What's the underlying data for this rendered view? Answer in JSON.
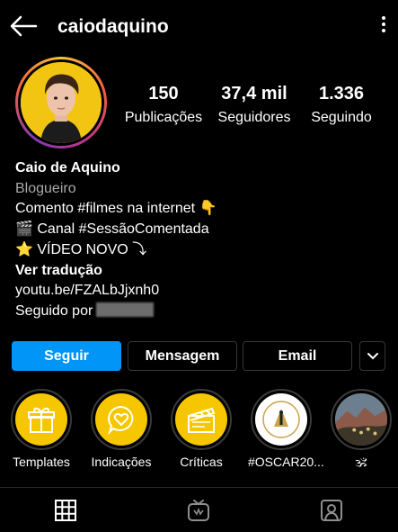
{
  "header": {
    "username": "caiodaquino"
  },
  "stats": [
    {
      "value": "150",
      "label": "Publicações"
    },
    {
      "value": "37,4 mil",
      "label": "Seguidores"
    },
    {
      "value": "1.336",
      "label": "Seguindo"
    }
  ],
  "bio": {
    "name": "Caio de Aquino",
    "category": "Blogueiro",
    "line1": "Comento #filmes na internet 👇",
    "line2": "🎬 Canal #SessãoComentada",
    "line3": "⭐ VÍDEO NOVO ⤵",
    "translate": "Ver tradução",
    "link": "youtu.be/FZALbJjxnh0",
    "followed_by": "Seguido por"
  },
  "buttons": {
    "follow": "Seguir",
    "message": "Mensagem",
    "email": "Email"
  },
  "highlights": [
    {
      "label": "Templates",
      "icon": "gift-icon"
    },
    {
      "label": "Indicações",
      "icon": "heart-chat-icon"
    },
    {
      "label": "Críticas",
      "icon": "clapperboard-icon"
    },
    {
      "label": "#OSCAR20...",
      "icon": "oscar-icon"
    },
    {
      "label": "🕉",
      "icon": "photo-thumbnail"
    }
  ],
  "colors": {
    "accent": "#0095f6",
    "highlight_yellow": "#f6c700",
    "background": "#000000"
  }
}
